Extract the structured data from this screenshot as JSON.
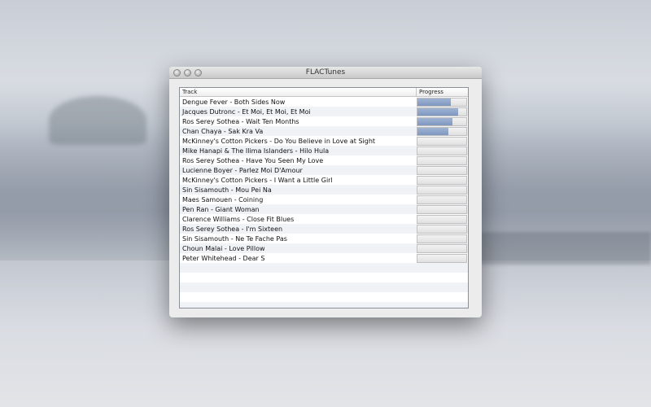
{
  "window": {
    "title": "FLACTunes"
  },
  "table": {
    "columns": [
      "Track",
      "Progress"
    ],
    "rows": [
      {
        "track": "Dengue Fever - Both Sides Now",
        "progress": 0.68
      },
      {
        "track": "Jacques Dutronc - Et Moi, Et Moi, Et Moi",
        "progress": 0.84
      },
      {
        "track": "Ros Serey Sothea - Wait Ten Months",
        "progress": 0.71
      },
      {
        "track": "Chan Chaya - Sak Kra Va",
        "progress": 0.63
      },
      {
        "track": "McKinney's Cotton Pickers - Do You Believe in Love at Sight",
        "progress": 0
      },
      {
        "track": "Mike Hanapi & The Ilima Islanders - Hilo Hula",
        "progress": 0
      },
      {
        "track": "Ros Serey Sothea - Have You Seen My Love",
        "progress": 0
      },
      {
        "track": "Lucienne Boyer - Parlez Moi D'Amour",
        "progress": 0
      },
      {
        "track": "McKinney's Cotton Pickers - I Want a Little Girl",
        "progress": 0
      },
      {
        "track": "Sin Sisamouth - Mou Pei Na",
        "progress": 0
      },
      {
        "track": "Maes Samouen - Coining",
        "progress": 0
      },
      {
        "track": "Pen Ran - Giant Woman",
        "progress": 0
      },
      {
        "track": "Clarence Williams - Close Fit Blues",
        "progress": 0
      },
      {
        "track": "Ros Serey Sothea - I'm Sixteen",
        "progress": 0
      },
      {
        "track": "Sin Sisamouth - Ne Te Fache Pas",
        "progress": 0
      },
      {
        "track": "Choun Malai - Love Pillow",
        "progress": 0
      },
      {
        "track": "Peter Whitehead - Dear S",
        "progress": 0
      }
    ]
  }
}
